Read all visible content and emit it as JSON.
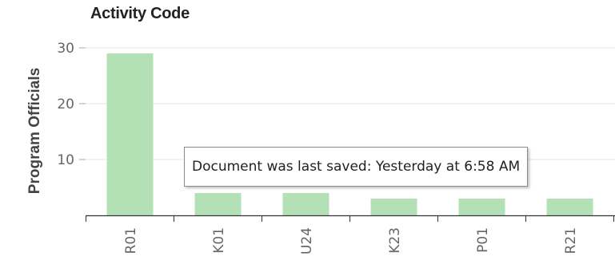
{
  "chart_data": {
    "type": "bar",
    "title": "Activity Code",
    "xlabel": "",
    "ylabel": "Program Officials",
    "categories": [
      "R01",
      "K01",
      "U24",
      "K23",
      "P01",
      "R21"
    ],
    "values": [
      29,
      4,
      4,
      3,
      3,
      3
    ],
    "ylim": [
      0,
      30
    ],
    "yticks": [
      10,
      20,
      30
    ],
    "grid": true,
    "legend": "none",
    "bar_color": "#b3e0b4"
  },
  "tooltip": {
    "text": "Document was last saved: Yesterday at 6:58 AM"
  }
}
